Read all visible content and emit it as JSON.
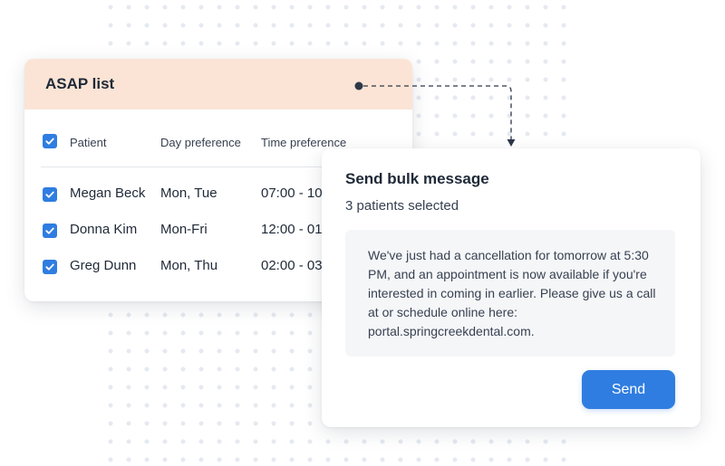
{
  "colors": {
    "accent": "#2f7de1",
    "asap_header_bg": "#fbe4d5",
    "message_bg": "#f5f6f8"
  },
  "asap_list": {
    "title": "ASAP list",
    "columns": {
      "patient": "Patient",
      "day_preference": "Day preference",
      "time_preference": "Time preference"
    },
    "select_all_checked": true,
    "rows": [
      {
        "checked": true,
        "patient": "Megan Beck",
        "day": "Mon, Tue",
        "time": "07:00 - 10"
      },
      {
        "checked": true,
        "patient": "Donna Kim",
        "day": "Mon-Fri",
        "time": "12:00 - 01"
      },
      {
        "checked": true,
        "patient": "Greg Dunn",
        "day": "Mon, Thu",
        "time": "02:00 - 03"
      }
    ]
  },
  "bulk_message": {
    "title": "Send bulk message",
    "subtitle": "3 patients selected",
    "message": "We've just had a cancellation for tomorrow at 5:30 PM, and an appointment is now available if you're interested in coming in earlier. Please give us a call at or schedule online here: portal.springcreekdental.com.",
    "send_label": "Send"
  },
  "icons": {
    "checkbox": "check-icon",
    "connector": "dashed-arrow-connector"
  }
}
